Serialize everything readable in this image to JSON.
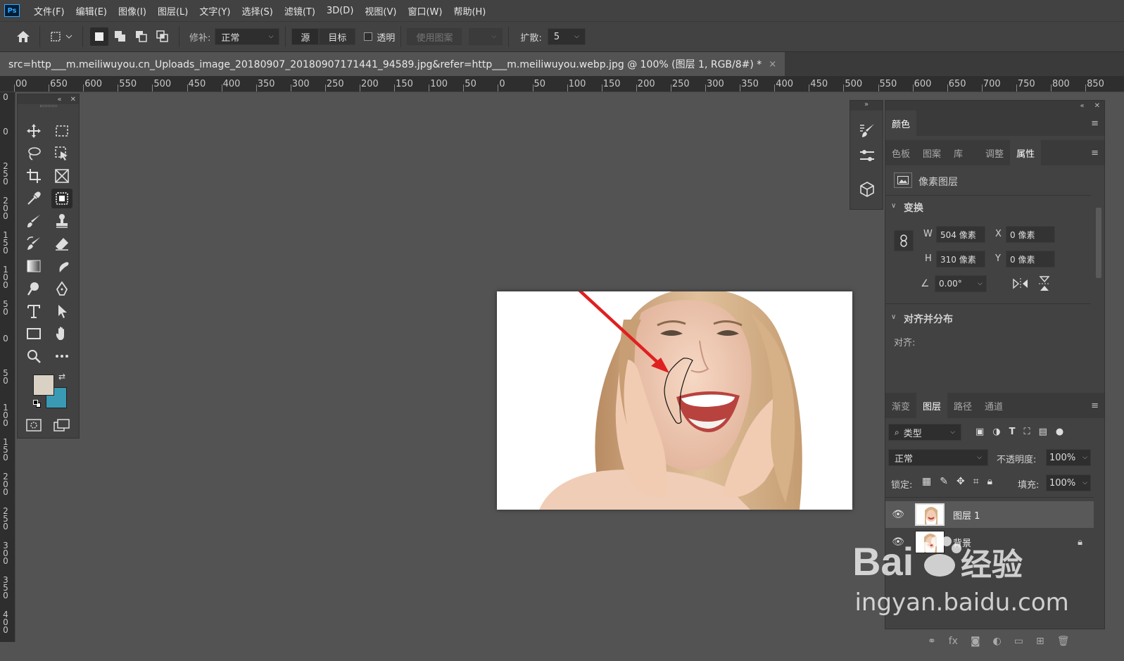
{
  "app": {
    "logo": "Ps"
  },
  "menubar": {
    "items": [
      "文件(F)",
      "编辑(E)",
      "图像(I)",
      "图层(L)",
      "文字(Y)",
      "选择(S)",
      "滤镜(T)",
      "3D(D)",
      "视图(V)",
      "窗口(W)",
      "帮助(H)"
    ]
  },
  "options": {
    "patch_label": "修补:",
    "patch_mode": "正常",
    "source_label": "源",
    "target_label": "目标",
    "transparent_label": "透明",
    "use_pattern_label": "使用图案",
    "diffusion_label": "扩散:",
    "diffusion_value": "5"
  },
  "document": {
    "tab_title": "src=http___m.meiliwuyou.cn_Uploads_image_20180907_20180907171441_94589.jpg&refer=http___m.meiliwuyou.webp.jpg @ 100% (图层 1, RGB/8#) *",
    "close_glyph": "×"
  },
  "rulers": {
    "horizontal": [
      "00",
      "650",
      "600",
      "550",
      "500",
      "450",
      "400",
      "350",
      "300",
      "250",
      "200",
      "150",
      "100",
      "50",
      "0",
      "50",
      "100",
      "150",
      "200",
      "250",
      "300",
      "350",
      "400",
      "450",
      "500",
      "550",
      "600",
      "650",
      "700",
      "750",
      "800",
      "850"
    ],
    "vertical": [
      "0",
      "0",
      "2 5 0",
      "2 0 0",
      "1 5 0",
      "1 0 0",
      "5 0",
      "0",
      "5 0",
      "1 0 0",
      "1 5 0",
      "2 0 0",
      "2 5 0",
      "3 0 0",
      "3 5 0",
      "4 0 0",
      "4"
    ]
  },
  "colors": {
    "foreground": "#d9d2c4",
    "background": "#3a9ab4",
    "accent_arrow": "#e02020"
  },
  "properties_panel": {
    "top_tab": "颜色",
    "tabs": [
      "色板",
      "图案",
      "库",
      "调整",
      "属性"
    ],
    "active_tab": "属性",
    "layer_type": "像素图层",
    "transform_label": "变换",
    "w_label": "W",
    "w_value": "504 像素",
    "h_label": "H",
    "h_value": "310 像素",
    "x_label": "X",
    "x_value": "0 像素",
    "y_label": "Y",
    "y_value": "0 像素",
    "angle_value": "0.00°",
    "align_label": "对齐并分布",
    "align_sub": "对齐:"
  },
  "layers_panel": {
    "tabs": [
      "渐变",
      "图层",
      "路径",
      "通道"
    ],
    "active_tab": "图层",
    "filter_label": "类型",
    "blend_mode": "正常",
    "opacity_label": "不透明度:",
    "opacity_value": "100%",
    "lock_label": "锁定:",
    "fill_label": "填充:",
    "fill_value": "100%",
    "layers": [
      {
        "name": "图层 1",
        "selected": true,
        "locked": false
      },
      {
        "name": "背景",
        "selected": false,
        "locked": true
      }
    ]
  },
  "watermark": {
    "brand": "Bai",
    "brand_suffix": "经验",
    "url": "jingyan.baidu.com"
  }
}
